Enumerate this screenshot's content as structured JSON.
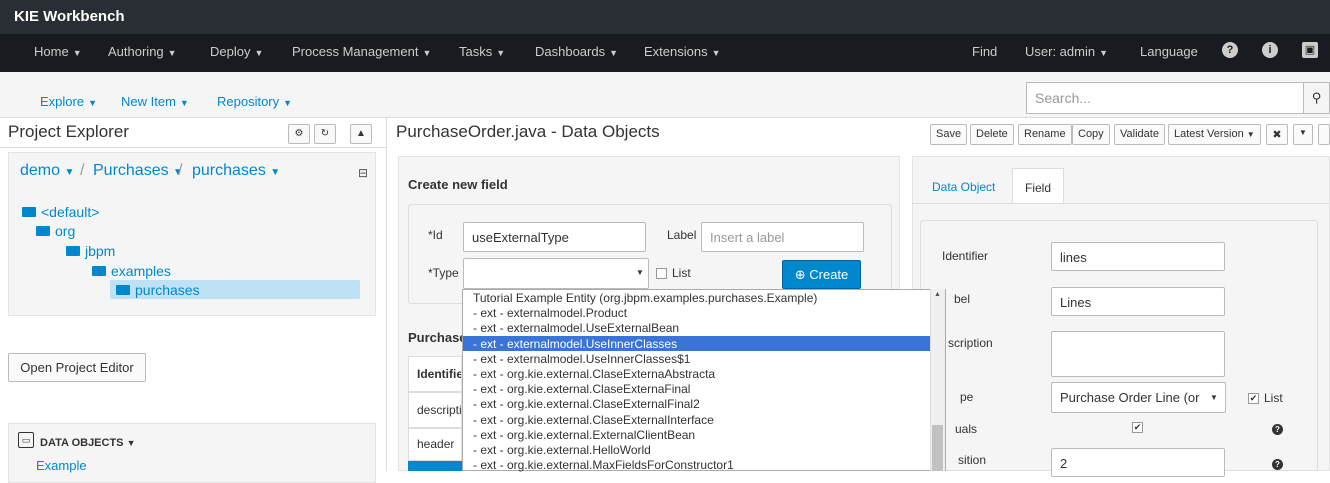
{
  "app": {
    "title": "KIE Workbench"
  },
  "topnav": {
    "home": "Home",
    "authoring": "Authoring",
    "deploy": "Deploy",
    "process_management": "Process Management",
    "tasks": "Tasks",
    "dashboards": "Dashboards",
    "extensions": "Extensions",
    "find": "Find",
    "user": "User: admin",
    "language": "Language"
  },
  "subnav": {
    "explore": "Explore",
    "new_item": "New Item",
    "repository": "Repository"
  },
  "search": {
    "placeholder": "Search..."
  },
  "project_explorer": {
    "title": "Project Explorer",
    "breadcrumb": [
      "demo",
      "Purchases",
      "purchases"
    ],
    "tree": [
      "<default>",
      "org",
      "jbpm",
      "examples",
      "purchases"
    ],
    "open_editor": "Open Project Editor",
    "data_objects_title": "DATA OBJECTS",
    "data_objects_first": "Example"
  },
  "editor": {
    "title": "PurchaseOrder.java - Data Objects",
    "toolbar": [
      "Save",
      "Delete",
      "Rename",
      "Copy",
      "Validate",
      "Latest Version"
    ],
    "create_field": {
      "title": "Create new field",
      "id_label": "*Id",
      "id_value": "useExternalType",
      "label_label": "Label",
      "label_placeholder": "Insert a label",
      "type_label": "*Type",
      "list_label": "List",
      "create_button": "Create"
    },
    "properties_title": "Purchase",
    "table": {
      "header": "Identifie",
      "rows": [
        "descripti",
        "header"
      ]
    }
  },
  "type_dropdown": {
    "options": [
      "Tutorial Example Entity (org.jbpm.examples.purchases.Example)",
      "- ext - externalmodel.Product",
      "- ext - externalmodel.UseExternalBean",
      "- ext - externalmodel.UseInnerClasses",
      "- ext - externalmodel.UseInnerClasses$1",
      "- ext - org.kie.external.ClaseExternaAbstracta",
      "- ext - org.kie.external.ClaseExternaFinal",
      "- ext - org.kie.external.ClaseExternalFinal2",
      "- ext - org.kie.external.ClaseExternalInterface",
      "- ext - org.kie.external.ExternalClientBean",
      "- ext - org.kie.external.HelloWorld",
      "- ext - org.kie.external.MaxFieldsForConstructor1"
    ],
    "selected": "- ext - externalmodel.UseInnerClasses"
  },
  "field_panel": {
    "tab_data_object": "Data Object",
    "tab_field": "Field",
    "identifier_label": "Identifier",
    "identifier_value": "lines",
    "label_label": "bel",
    "label_value": "Lines",
    "description_label": "scription",
    "type_label": "pe",
    "type_value": "Purchase Order Line (or",
    "list_label": "List",
    "equals_label": "uals",
    "position_label": "sition",
    "position_value": "2"
  },
  "colors": {
    "accent": "#0088ce",
    "topbar": "#292e34",
    "navbar": "#181b1f",
    "selection": "#3875d7"
  }
}
